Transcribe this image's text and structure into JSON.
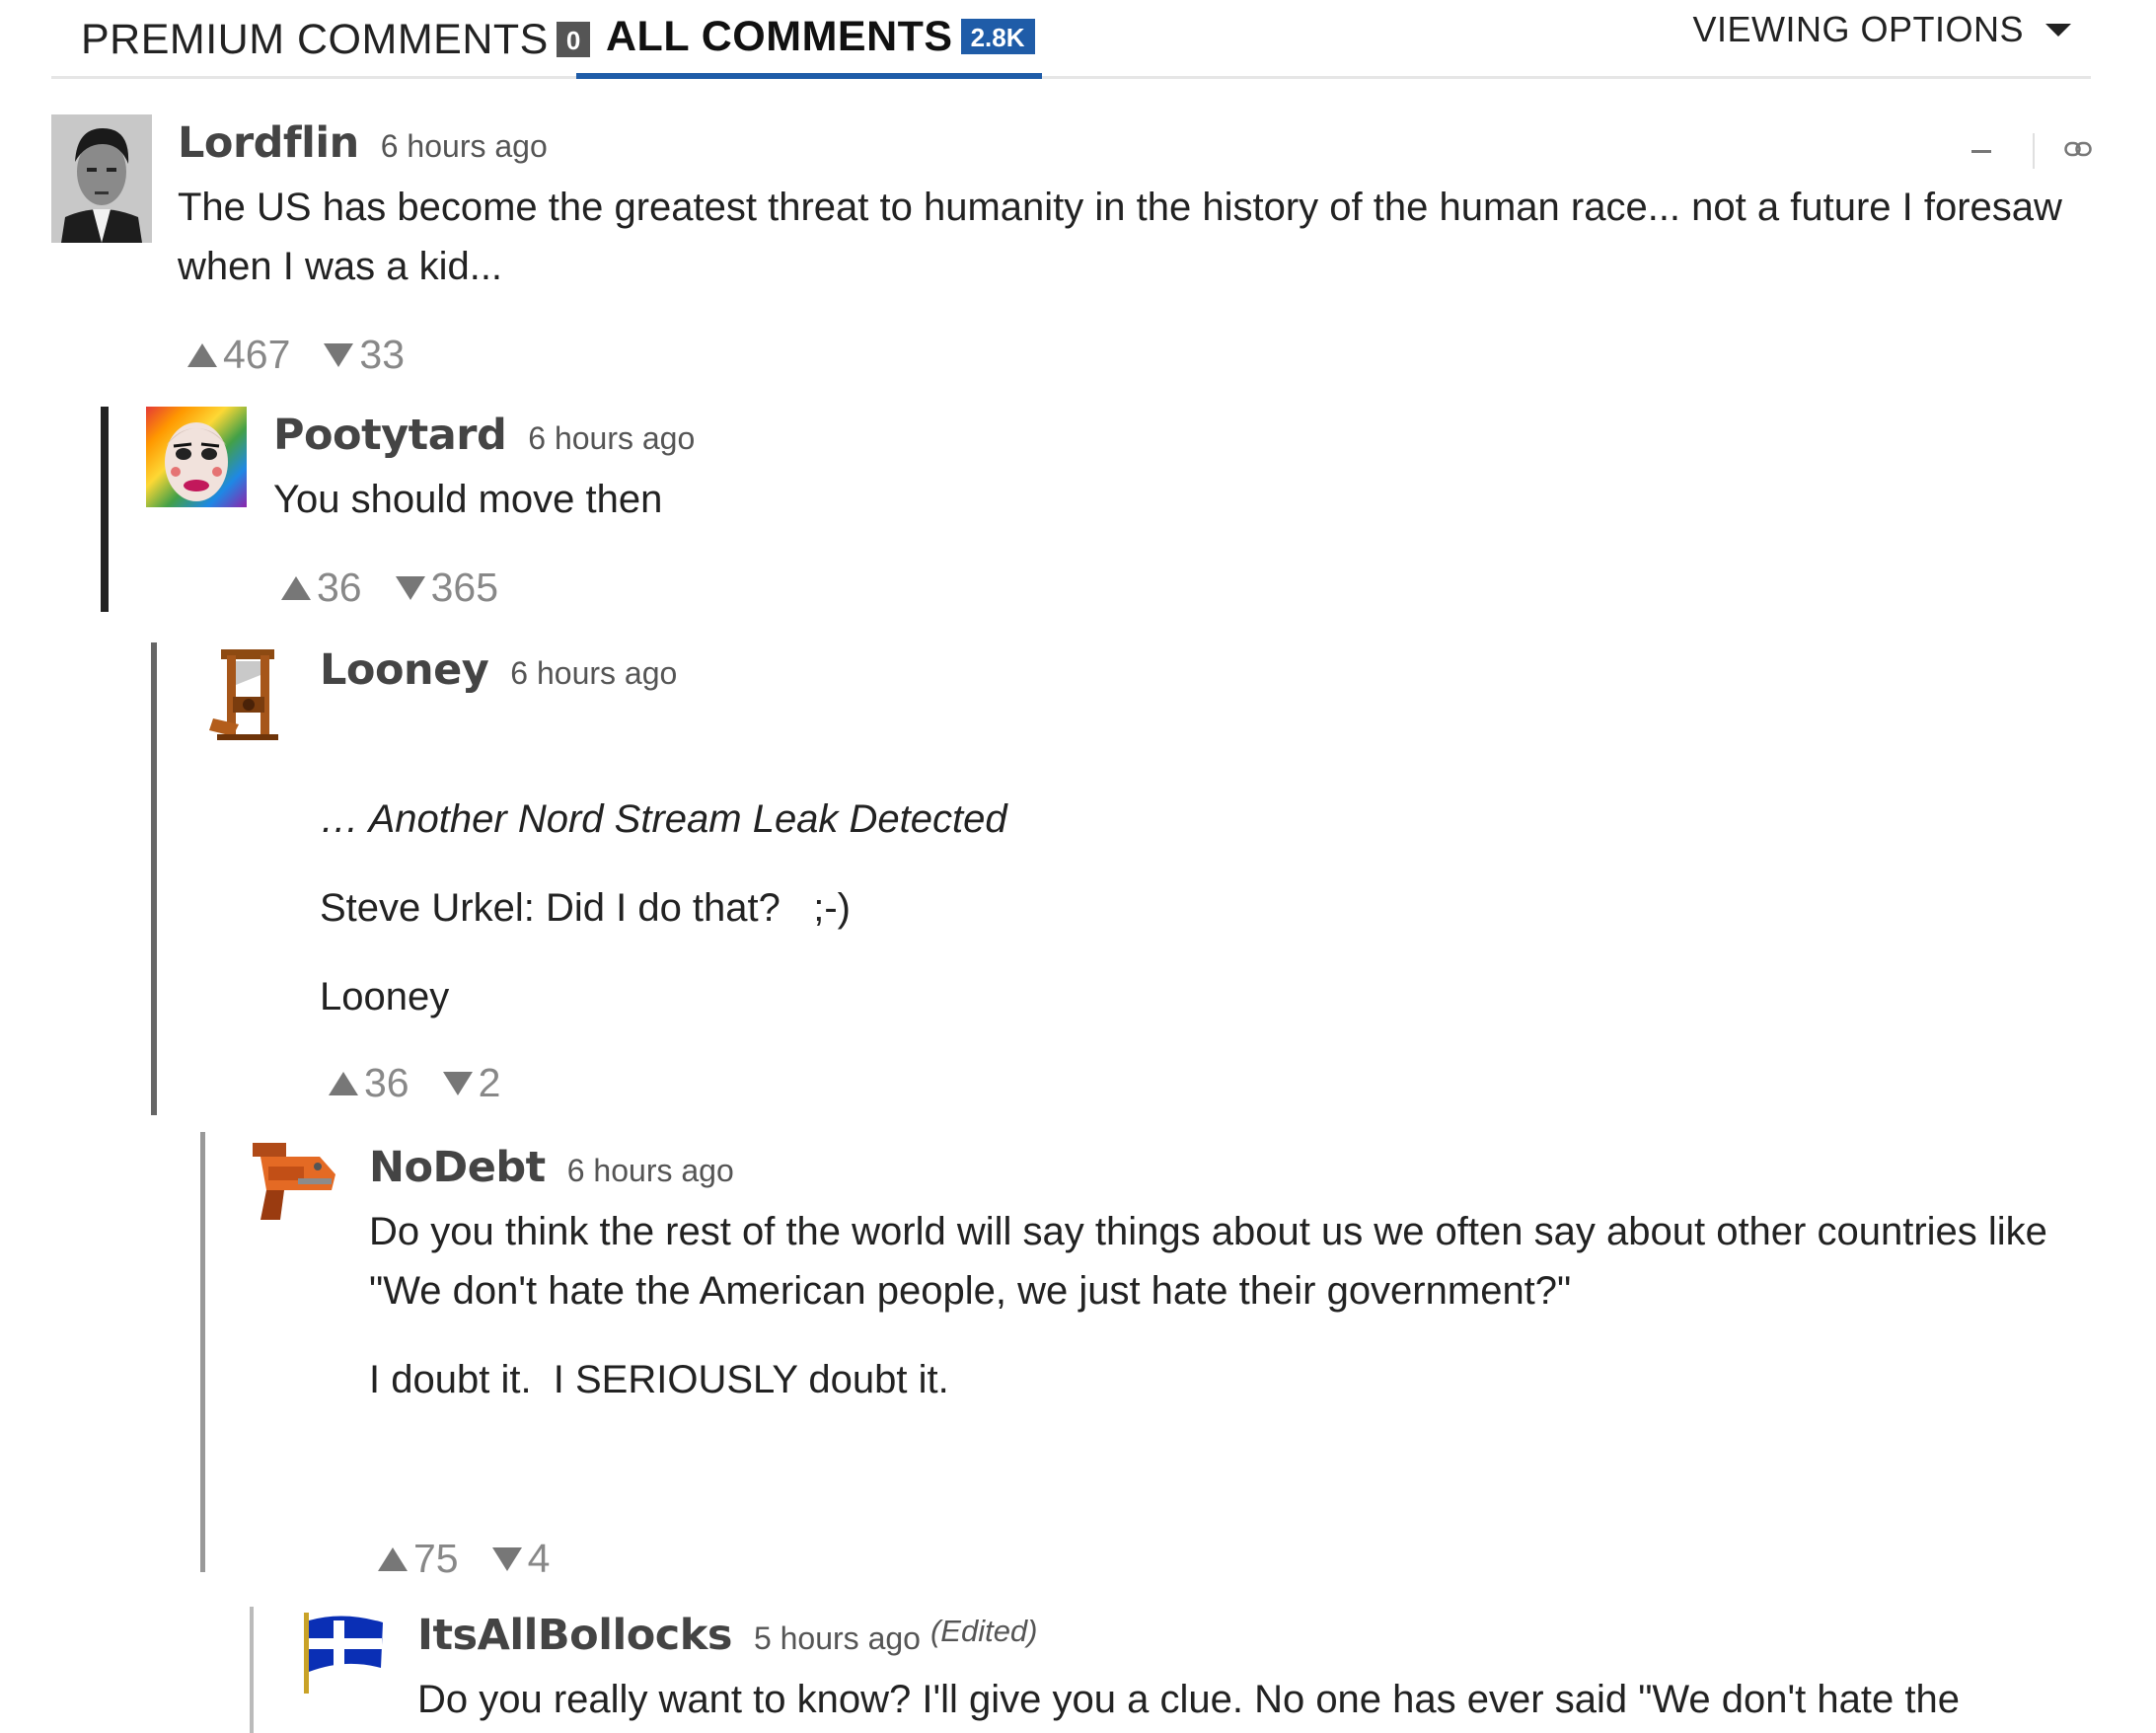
{
  "tabs": {
    "premium": {
      "label": "PREMIUM COMMENTS",
      "count": "0"
    },
    "all": {
      "label": "ALL COMMENTS",
      "count": "2.8K"
    }
  },
  "viewing_options": {
    "label": "VIEWING OPTIONS",
    "icon": "caret-down-icon"
  },
  "colors": {
    "accent": "#1f5ca8",
    "thread_dark": "#222222",
    "thread_mid": "#777777",
    "thread_light": "#aaaaaa"
  },
  "comments": [
    {
      "username": "Lordflin",
      "time": "6 hours ago",
      "body": [
        "The US has become the greatest threat to humanity in the history of the human race... not a future I foresaw when I was a kid..."
      ],
      "up": "467",
      "down": "33",
      "avatar": "portrait-avatar"
    },
    {
      "username": "Pootytard",
      "time": "6 hours ago",
      "body": [
        "You should move then"
      ],
      "up": "36",
      "down": "365",
      "avatar": "clown-face-avatar"
    },
    {
      "username": "Looney",
      "time": "6 hours ago",
      "body": [
        "… Another Nord Stream Leak Detected",
        "Steve Urkel: Did I do that?   ;-)",
        "Looney"
      ],
      "up": "36",
      "down": "2",
      "avatar": "guillotine-avatar"
    },
    {
      "username": "NoDebt",
      "time": "6 hours ago",
      "body": [
        "Do you think the rest of the world will say things about us we often say about other countries like \"We don't hate the American people, we just hate their government?\"",
        "I doubt it.  I SERIOUSLY doubt it."
      ],
      "up": "75",
      "down": "4",
      "avatar": "nail-gun-avatar"
    },
    {
      "username": "ItsAllBollocks",
      "time": "5 hours ago",
      "edited": "(Edited)",
      "body": [
        "Do you really want to know? I'll give you a clue. No one has ever said \"We don't hate the"
      ],
      "avatar": "flag-avatar"
    }
  ]
}
